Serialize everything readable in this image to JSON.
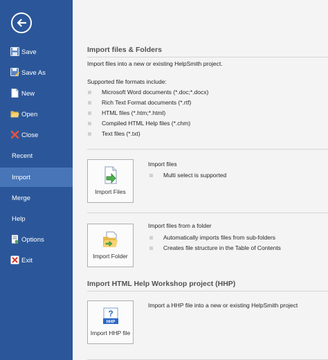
{
  "sidebar": {
    "items": [
      {
        "label": "Save",
        "icon": "save-icon"
      },
      {
        "label": "Save As",
        "icon": "save-as-icon"
      },
      {
        "label": "New",
        "icon": "new-document-icon"
      },
      {
        "label": "Open",
        "icon": "folder-open-icon"
      },
      {
        "label": "Close",
        "icon": "close-icon"
      },
      {
        "label": "Recent"
      },
      {
        "label": "Import"
      },
      {
        "label": "Merge"
      },
      {
        "label": "Help"
      },
      {
        "label": "Options",
        "icon": "options-icon"
      },
      {
        "label": "Exit",
        "icon": "exit-icon"
      }
    ],
    "active": "Import"
  },
  "import_files_folders": {
    "title": "Import files & Folders",
    "description": "Import files into a new or existing HelpSmith project.",
    "formats_heading": "Supported file formats include:",
    "formats": [
      "Microsoft Word documents (*.doc;*.docx)",
      "Rich Text Format documents (*.rtf)",
      "HTML files (*.htm;*.html)",
      "Compiled HTML Help files (*.chm)",
      "Text files (*.txt)"
    ]
  },
  "import_files": {
    "button_label": "Import Files",
    "info_title": "Import files",
    "info_items": [
      "Multi select is supported"
    ]
  },
  "import_folder": {
    "button_label": "Import Folder",
    "info_title": "Import files from a folder",
    "info_items": [
      "Automatically imports files from sub-folders",
      "Creates file structure in the Table of Contents"
    ]
  },
  "import_hhp": {
    "title": "Import HTML Help Workshop project (HHP)",
    "button_label": "Import HHP file",
    "info_title": "Import a HHP file into a new or existing HelpSmith project",
    "icon_text": "HHP"
  },
  "colors": {
    "sidebar": "#2b579a",
    "sidebar_active": "#4775b8",
    "background": "#f4f4f4"
  }
}
